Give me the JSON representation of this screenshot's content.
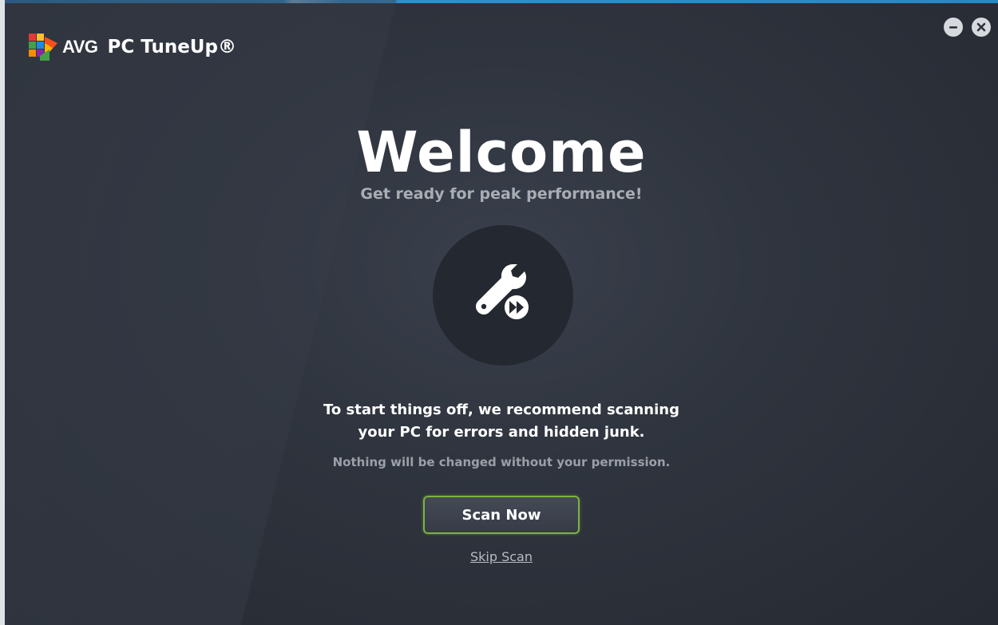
{
  "app": {
    "brand": "AVG",
    "product": "PC TuneUp®"
  },
  "window_controls": {
    "minimize_icon": "minus-icon",
    "close_icon": "close-icon"
  },
  "welcome": {
    "title": "Welcome",
    "subtitle": "Get ready for peak performance!",
    "icon": "wrench-fast-forward-icon"
  },
  "message": {
    "line1": "To start things off, we recommend scanning",
    "line2": "your PC for errors and hidden junk.",
    "note": "Nothing will be changed without your permission."
  },
  "actions": {
    "scan_label": "Scan Now",
    "skip_label": "Skip Scan"
  },
  "colors": {
    "accent_green": "#7cb342",
    "background": "#2f343e",
    "top_strip_blue": "#2a86c6"
  }
}
